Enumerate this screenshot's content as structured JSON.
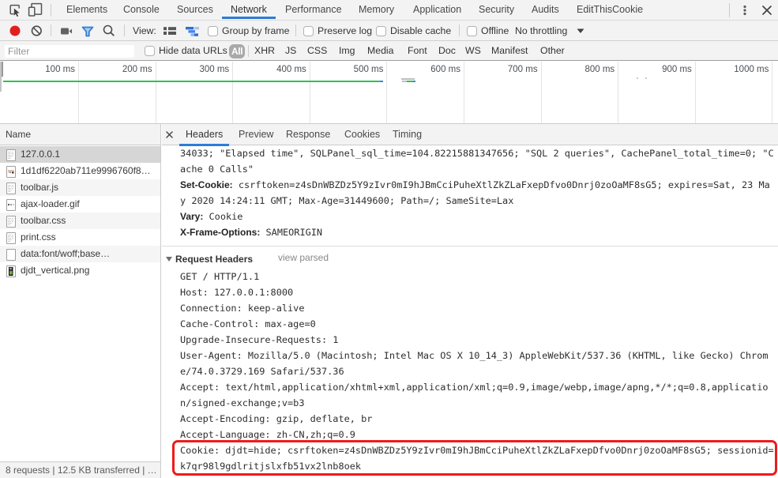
{
  "accent": {
    "blue": "#2c7cd6",
    "red_record": "#e01f1f",
    "red_box": "#ef1d1d",
    "green_bar": "#2bc253",
    "toolbar_bg": "#f3f3f3"
  },
  "main_tabs": {
    "items": [
      "Elements",
      "Console",
      "Sources",
      "Network",
      "Performance",
      "Memory",
      "Application",
      "Security",
      "Audits",
      "EditThisCookie"
    ],
    "active": "Network"
  },
  "toolbar": {
    "view_label": "View:",
    "group_by_frame": "Group by frame",
    "preserve_log": "Preserve log",
    "disable_cache": "Disable cache",
    "offline": "Offline",
    "throttling": "No throttling"
  },
  "filter_bar": {
    "placeholder": "Filter",
    "hide_data_urls": "Hide data URLs",
    "types": [
      "All",
      "XHR",
      "JS",
      "CSS",
      "Img",
      "Media",
      "Font",
      "Doc",
      "WS",
      "Manifest",
      "Other"
    ],
    "active_type": "All"
  },
  "timeline": {
    "ticks": [
      "100 ms",
      "200 ms",
      "300 ms",
      "400 ms",
      "500 ms",
      "600 ms",
      "700 ms",
      "800 ms",
      "900 ms",
      "1000 ms"
    ]
  },
  "requests": {
    "header": "Name",
    "rows": [
      {
        "name": "127.0.0.1",
        "icon": "document",
        "selected": true
      },
      {
        "name": "1d1df6220ab711e9996760f8…",
        "icon": "image-photo",
        "selected": false
      },
      {
        "name": "toolbar.js",
        "icon": "document",
        "selected": false
      },
      {
        "name": "ajax-loader.gif",
        "icon": "image-loader",
        "selected": false
      },
      {
        "name": "toolbar.css",
        "icon": "document",
        "selected": false
      },
      {
        "name": "print.css",
        "icon": "document",
        "selected": false
      },
      {
        "name": "data:font/woff;base…",
        "icon": "blank",
        "selected": false
      },
      {
        "name": "djdt_vertical.png",
        "icon": "image-dark",
        "selected": false
      }
    ]
  },
  "status_bar": {
    "text": "8 requests | 12.5 KB transferred | …"
  },
  "details": {
    "close_label": "×",
    "tabs": [
      "Headers",
      "Preview",
      "Response",
      "Cookies",
      "Timing"
    ],
    "active_tab": "Headers",
    "response_header_lines": [
      {
        "name": "",
        "text": "34033; \"Elapsed time\", SQLPanel_sql_time=104.82215881347656; \"SQL 2 queries\", CachePanel_total_time=0; \"C"
      },
      {
        "name": "",
        "text": "ache 0 Calls\""
      },
      {
        "name": "Set-Cookie:",
        "text": " csrftoken=z4sDnWBZDz5Y9zIvr0mI9hJBmCciPuheXtlZkZLaFxepDfvo0Dnrj0zoOaMF8sG5; expires=Sat, 23 Ma"
      },
      {
        "name": "",
        "text": "y 2020 14:24:11 GMT; Max-Age=31449600; Path=/; SameSite=Lax"
      },
      {
        "name": "Vary:",
        "text": " Cookie"
      },
      {
        "name": "X-Frame-Options:",
        "text": " SAMEORIGIN"
      }
    ],
    "request_section": {
      "title": "Request Headers",
      "link": "view parsed"
    },
    "request_header_lines": [
      "GET / HTTP/1.1",
      "Host: 127.0.0.1:8000",
      "Connection: keep-alive",
      "Cache-Control: max-age=0",
      "Upgrade-Insecure-Requests: 1",
      "User-Agent: Mozilla/5.0 (Macintosh; Intel Mac OS X 10_14_3) AppleWebKit/537.36 (KHTML, like Gecko) Chrom",
      "e/74.0.3729.169 Safari/537.36",
      "Accept: text/html,application/xhtml+xml,application/xml;q=0.9,image/webp,image/apng,*/*;q=0.8,applicatio",
      "n/signed-exchange;v=b3",
      "Accept-Encoding: gzip, deflate, br",
      "Accept-Language: zh-CN,zh;q=0.9",
      "Cookie: djdt=hide; csrftoken=z4sDnWBZDz5Y9zIvr0mI9hJBmCciPuheXtlZkZLaFxepDfvo0Dnrj0zoOaMF8sG5; sessionid=",
      "k7qr98l9gdlritjslxfb51vx2lnb8oek"
    ]
  }
}
